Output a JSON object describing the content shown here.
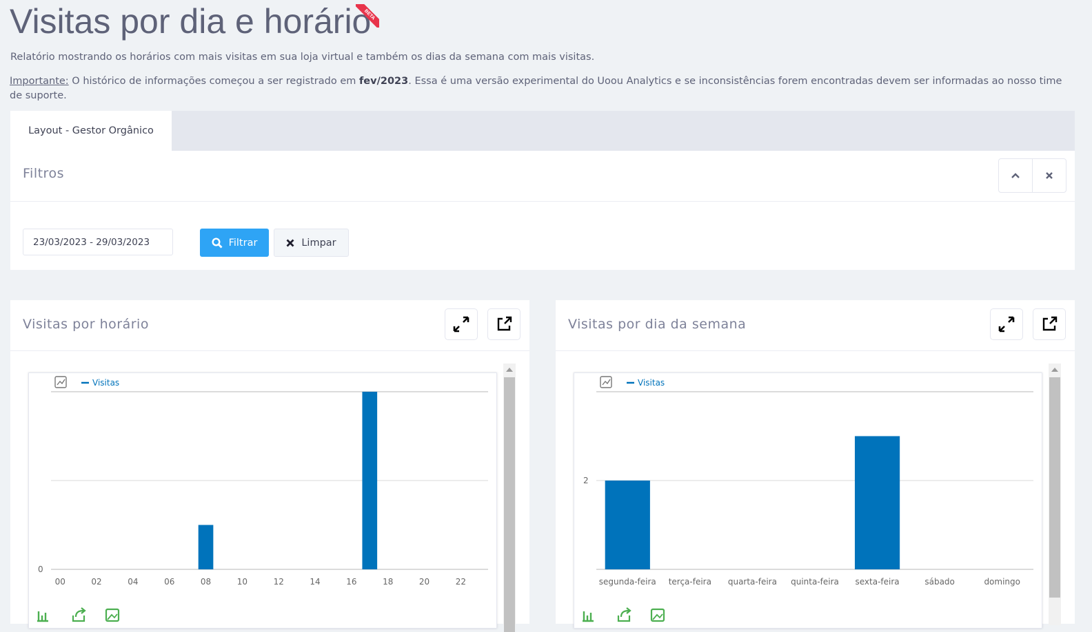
{
  "page": {
    "title": "Visitas por dia e horário",
    "beta_badge": "BETA",
    "description": "Relatório mostrando os horários com mais visitas em sua loja virtual e também os dias da semana com mais visitas.",
    "important_label": "Importante:",
    "important_text_1": " O histórico de informações começou a ser registrado em ",
    "important_bold": "fev/2023",
    "important_text_2": ". Essa é uma versão experimental do Uoou Analytics e se inconsistências forem encontradas devem ser informadas ao nosso time de suporte."
  },
  "tabs": [
    {
      "label": "Layout - Gestor Orgânico",
      "active": true
    }
  ],
  "filters": {
    "title": "Filtros",
    "date_range_value": "23/03/2023 - 29/03/2023",
    "filter_button": "Filtrar",
    "clear_button": "Limpar"
  },
  "colors": {
    "bar": "#0073bb",
    "primary_button": "#2ea4f5",
    "beta": "#e8344b",
    "chart_toolbar": "#4caf50"
  },
  "icons": [
    "chevron-up-icon",
    "close-icon",
    "search-icon",
    "x-icon",
    "expand-icon",
    "external-link-icon",
    "chart-type-icon",
    "bar-chart-icon",
    "share-icon",
    "image-icon"
  ],
  "chart_data": [
    {
      "type": "bar",
      "title": "Visitas por horário",
      "legend": "Visitas",
      "y_tick_labels": [
        "0"
      ],
      "x_tick_labels": [
        "00",
        "02",
        "04",
        "06",
        "08",
        "10",
        "12",
        "14",
        "16",
        "18",
        "20",
        "22"
      ],
      "x": [
        0,
        1,
        2,
        3,
        4,
        5,
        6,
        7,
        8,
        9,
        10,
        11,
        12,
        13,
        14,
        15,
        16,
        17,
        18,
        19,
        20,
        21,
        22,
        23
      ],
      "series": [
        {
          "name": "Visitas",
          "values": [
            0,
            0,
            0,
            0,
            0,
            0,
            0,
            0,
            1,
            0,
            0,
            0,
            0,
            0,
            0,
            0,
            0,
            4,
            0,
            0,
            0,
            0,
            0,
            0
          ]
        }
      ],
      "ylim": [
        0,
        4
      ],
      "grid": true,
      "legend_position": "top-left"
    },
    {
      "type": "bar",
      "title": "Visitas por dia da semana",
      "legend": "Visitas",
      "y_tick_labels": [
        "2"
      ],
      "categories": [
        "segunda-feira",
        "terça-feira",
        "quarta-feira",
        "quinta-feira",
        "sexta-feira",
        "sábado",
        "domingo"
      ],
      "series": [
        {
          "name": "Visitas",
          "values": [
            2,
            0,
            0,
            0,
            3,
            0,
            0
          ]
        }
      ],
      "ylim": [
        0,
        4
      ],
      "grid": true,
      "legend_position": "top-left"
    }
  ]
}
